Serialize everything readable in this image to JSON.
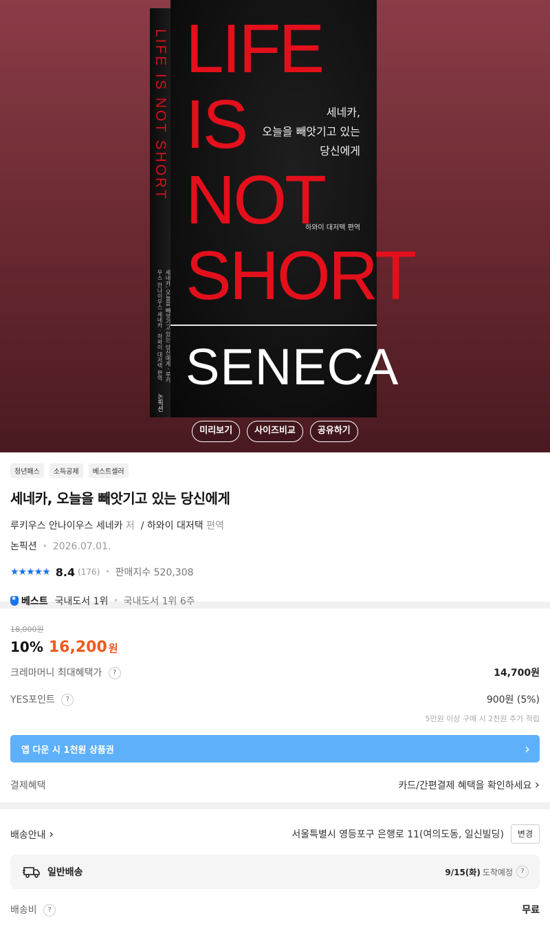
{
  "cover": {
    "spine_title": "LIFE IS NOT SHORT",
    "spine_subtitle": "세네카, 오늘을 빼앗기고 있는 당신에게 · 루키우스 안나이우스 세네카 · 하와이 대저택 편역",
    "spine_publisher": "논픽션",
    "title_lines": [
      "LIFE",
      "IS",
      "NOT",
      "SHORT"
    ],
    "subtitle_lines": [
      "세네카,",
      "오늘을 빼앗기고 있는",
      "당신에게"
    ],
    "translator": "하와이 대저택 편역",
    "author": "SENECA"
  },
  "hero_buttons": [
    "미리보기",
    "사이즈비교",
    "공유하기"
  ],
  "badges": [
    "청년패스",
    "소득공제",
    "베스트셀러"
  ],
  "title": "세네카, 오늘을 빼앗기고 있는 당신에게",
  "author": {
    "name": "루키우스 안나이우스 세네카",
    "role": "저",
    "sep": "/",
    "translator": "하와이 대저택",
    "translator_role": "편역"
  },
  "publisher": "논픽션",
  "pub_date": "2026.07.01.",
  "rating": {
    "stars": "★★★★★",
    "score": "8.4",
    "count": "(176)",
    "sales_label": "판매지수 520,308"
  },
  "best": {
    "label": "베스트",
    "rank": "국내도서 1위",
    "week": "국내도서 1위 6주"
  },
  "price": {
    "original": "18,000원",
    "discount": "10%",
    "sale": "16,200",
    "won": "원",
    "crema_label": "크레마머니 최대혜택가",
    "crema_value": "14,700원",
    "points_label": "YES포인트",
    "points_value": "900원 (5%)",
    "points_note": "5만원 이상 구매 시 2천원 추가 적립",
    "app_banner": "앱 다운 시 1천원 상품권",
    "pay_label": "결제혜택",
    "pay_link": "카드/간편결제 혜택을 확인하세요"
  },
  "delivery": {
    "label": "배송안내",
    "address": "서울특별시 영등포구 은행로 11(여의도동, 일신빌딩)",
    "change": "변경",
    "type": "일반배송",
    "date": "9/15(화)",
    "date_suffix": "도착예정",
    "fee_label": "배송비",
    "fee_value": "무료"
  },
  "icons": {
    "chevron": "›",
    "question": "?",
    "truck": "truck-icon",
    "best_badge": "ribbon-icon"
  },
  "colors": {
    "accent": "#ee5a20",
    "brand_blue": "#1a73e8",
    "banner": "#5fb0fa",
    "cover_red": "#e3101c"
  }
}
